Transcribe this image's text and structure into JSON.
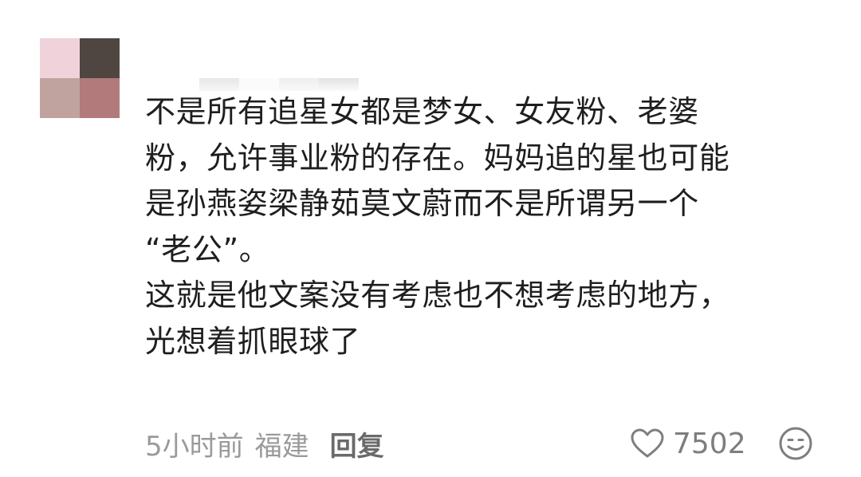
{
  "comment": {
    "lines": [
      "不是所有追星女都是梦女、女友粉、老婆",
      "粉，允许事业粉的存在。妈妈追的星也可能",
      "是孙燕姿梁静茹莫文蔚而不是所谓另一个",
      "“老公”。",
      "这就是他文案没有考虑也不想考虑的地方，",
      "光想着抓眼球了"
    ],
    "time": "5小时前",
    "location": "福建",
    "reply_label": "回复",
    "like_count": "7502"
  },
  "icons": {
    "like": "heart-outline-icon",
    "emoji": "smiley-face-icon"
  },
  "colors": {
    "text": "#1e1e1e",
    "meta": "#9a9a9a",
    "reply": "#6a6a6a",
    "icon": "#7e7e7e"
  }
}
